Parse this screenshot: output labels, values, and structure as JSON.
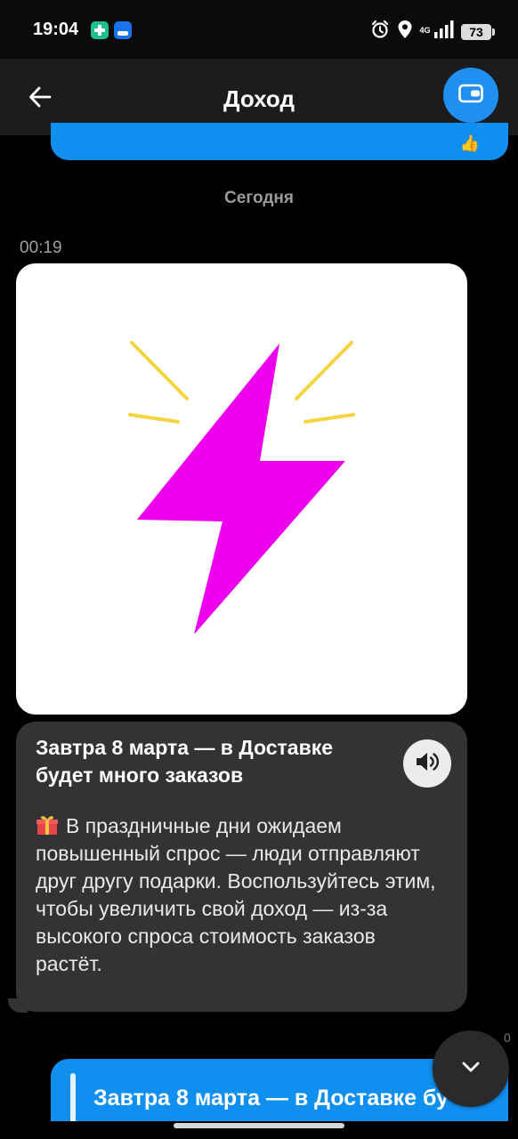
{
  "status_bar": {
    "time": "19:04",
    "network": "4G",
    "battery": "73",
    "icons": [
      "medical-app-icon",
      "messenger-app-icon",
      "alarm-icon",
      "location-icon",
      "signal-icon",
      "battery-icon"
    ]
  },
  "header": {
    "title": "Доход",
    "back_icon": "arrow-left-icon",
    "wallet_icon": "wallet-icon"
  },
  "chat": {
    "previous_message_emoji": "👍",
    "date_separator": "Сегодня",
    "message": {
      "time": "00:19",
      "image_icon": "lightning-bolt-icon",
      "title": "Завтра 8 марта — в Доставке будет много заказов",
      "body": "В праздничные дни ожидаем повышенный спрос — люди отправляют друг другу подарки. Воспользуйтесь этим, чтобы увеличить свой доход — из-за высокого спроса стоимость заказов растёт.",
      "gift_icon": "gift-icon",
      "speaker_icon": "speaker-icon"
    },
    "next_message_preview": "Завтра 8 марта — в Доставке бу",
    "corner_fragment": "0"
  },
  "colors": {
    "accent_blue": "#0f8ff0",
    "bolt_magenta": "#ee00ee",
    "rays_yellow": "#f5d440",
    "bubble_dark": "#333335"
  }
}
